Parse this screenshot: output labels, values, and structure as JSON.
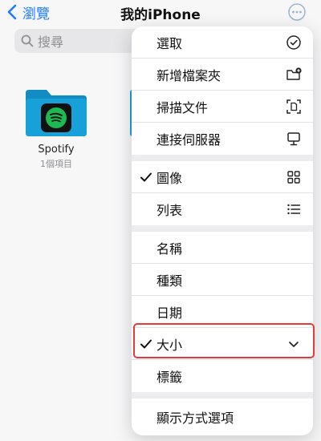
{
  "nav": {
    "back_label": "瀏覽",
    "title": "我的iPhone"
  },
  "search": {
    "placeholder": "搜尋"
  },
  "folder": {
    "name": "Spotify",
    "count": "1個項目"
  },
  "menu": {
    "select": "選取",
    "new_folder": "新增檔案夾",
    "scan": "掃描文件",
    "connect_server": "連接伺服器",
    "view_icons": "圖像",
    "view_list": "列表",
    "sort_name": "名稱",
    "sort_kind": "種類",
    "sort_date": "日期",
    "sort_size": "大小",
    "sort_tags": "標籤",
    "view_options": "顯示方式選項"
  },
  "state": {
    "selected_view": "圖像",
    "selected_sort": "大小"
  },
  "colors": {
    "accent": "#1f7cf6",
    "folder": "#18a0d9",
    "spotify": "#1db954",
    "highlight": "#e53a3a"
  }
}
